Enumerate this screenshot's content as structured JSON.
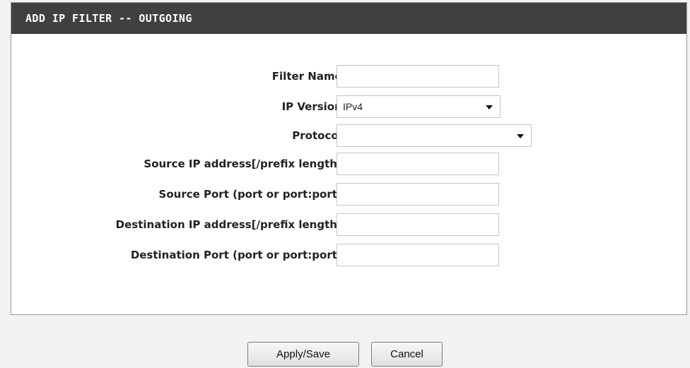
{
  "panel": {
    "title": "ADD IP FILTER -- OUTGOING"
  },
  "form": {
    "filter_name": {
      "label": "Filter Name :",
      "value": ""
    },
    "ip_version": {
      "label": "IP Version :",
      "value": "IPv4"
    },
    "protocol": {
      "label": "Protocol :",
      "value": ""
    },
    "source_ip": {
      "label": "Source IP address[/prefix length] :",
      "value": ""
    },
    "source_port": {
      "label": "Source Port (port or port:port) :",
      "value": ""
    },
    "dest_ip": {
      "label": "Destination IP address[/prefix length] :",
      "value": ""
    },
    "dest_port": {
      "label": "Destination Port (port or port:port) :",
      "value": ""
    }
  },
  "buttons": {
    "apply_save": "Apply/Save",
    "cancel": "Cancel"
  },
  "icons": {
    "dropdown": "chevron-down-icon"
  }
}
